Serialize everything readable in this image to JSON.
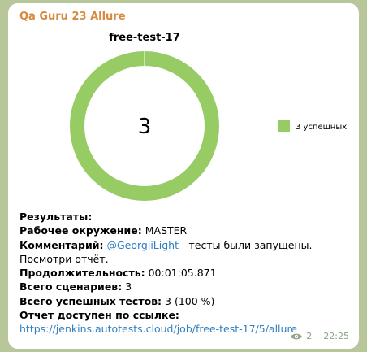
{
  "message": {
    "sender": "Qa Guru 23 Allure",
    "views": "2",
    "time": "22:25",
    "lines": {
      "results": "Результаты:",
      "env_label": "Рабочее окружение:",
      "env_value": "MASTER",
      "comment_label": "Комментарий:",
      "comment_mention": "@GeorgiiLight",
      "comment_text": "- тесты были запущены. Посмотри отчёт.",
      "duration_label": "Продолжительность:",
      "duration_value": "00:01:05.871",
      "scenarios_label": "Всего сценариев:",
      "scenarios_value": "3",
      "passed_label": "Всего успешных тестов:",
      "passed_value": "3 (100 %)",
      "report_label": "Отчет доступен по ссылке:",
      "report_url": "https://jenkins.autotests.cloud/job/free-test-17/5/allure"
    }
  },
  "chart_data": {
    "type": "pie",
    "title": "free-test-17",
    "center_label": "3",
    "categories": [
      "3 успешных"
    ],
    "values": [
      3
    ],
    "colors": [
      "#97cc64"
    ],
    "legend_position": "right"
  }
}
